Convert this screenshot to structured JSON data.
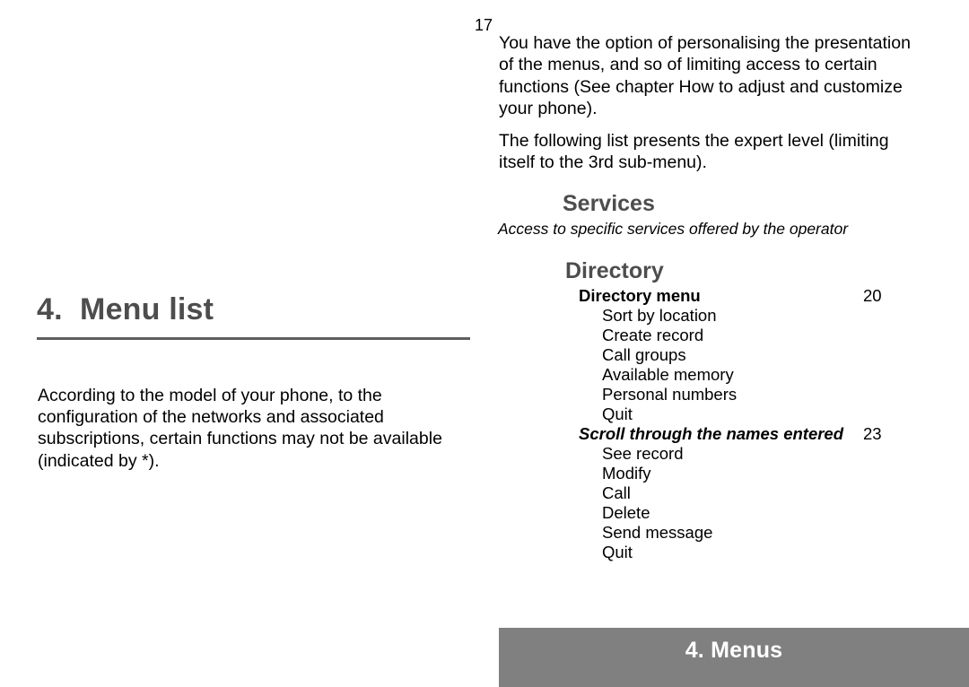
{
  "page": {
    "number": "17",
    "background": "#ffffff"
  },
  "left_column": {
    "chapter_heading": "4.  Menu list",
    "rule_color": "#5e5e5e",
    "heading_color": "#4d4d4d",
    "intro_paragraph": "According to the model of your phone, to the configuration of the networks and associated subscriptions, certain functions may not be available (indicated by *)."
  },
  "right_column": {
    "paragraphs": [
      "You have the option of personalising the presentation of the menus, and so of limiting access to certain functions (See chapter How to adjust and customize your phone).",
      "The following list presents the expert level (limiting itself to the 3rd sub-menu)."
    ],
    "sections": [
      {
        "heading": "Services",
        "subtitle": "Access to specific services offered by the operator"
      },
      {
        "heading": "Directory",
        "subtitle": ""
      }
    ]
  },
  "menu_list": {
    "entries": [
      {
        "label": "Directory menu",
        "style": "bold",
        "page": "20",
        "items": [
          "Sort by location",
          "Create record",
          "Call groups",
          "Available memory",
          "Personal numbers",
          "Quit"
        ]
      },
      {
        "label": "Scroll through the names entered",
        "style": "bolditalic",
        "page": "23",
        "items": [
          "See record",
          "Modify",
          "Call",
          "Delete",
          "Send message",
          "Quit"
        ]
      }
    ]
  },
  "footer": {
    "text": "4. Menus",
    "background": "#808080",
    "text_color": "#ffffff"
  }
}
